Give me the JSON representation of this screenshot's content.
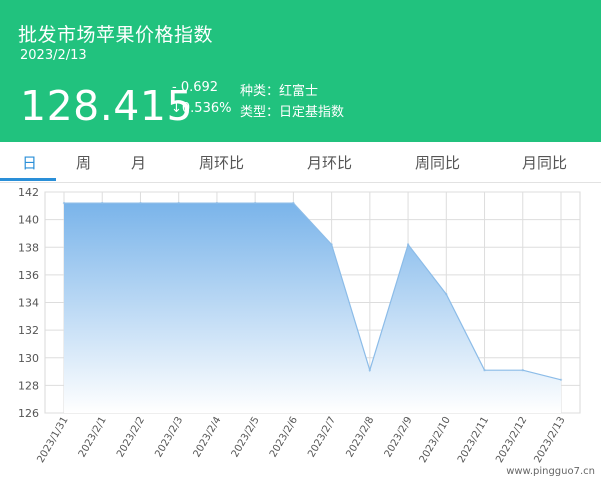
{
  "header": {
    "title": "批发市场苹果价格指数",
    "date": "2023/2/13",
    "value": "128.415",
    "change": "- 0.692",
    "change_pct": "↓0.536%",
    "variety_label": "种类：红富士",
    "type_label": "类型：日定基指数"
  },
  "tabs": [
    {
      "label": "日",
      "active": true
    },
    {
      "label": "周",
      "active": false
    },
    {
      "label": "月",
      "active": false
    },
    {
      "label": "周环比",
      "active": false
    },
    {
      "label": "月环比",
      "active": false
    },
    {
      "label": "周同比",
      "active": false
    },
    {
      "label": "月同比",
      "active": false
    }
  ],
  "colors": {
    "header_bg": "#21c27e",
    "accent": "#2a8fd8",
    "series_top": "#7ab4ea",
    "series_bottom": "#ffffff",
    "series_line": "#8cbce8"
  },
  "watermark": "www.pingguo7.cn",
  "chart_data": {
    "type": "area",
    "x": [
      "2023/1/31",
      "2023/2/1",
      "2023/2/2",
      "2023/2/3",
      "2023/2/4",
      "2023/2/5",
      "2023/2/6",
      "2023/2/7",
      "2023/2/8",
      "2023/2/9",
      "2023/2/10",
      "2023/2/11",
      "2023/2/12",
      "2023/2/13"
    ],
    "values": [
      141.2,
      141.2,
      141.2,
      141.2,
      141.2,
      141.2,
      141.2,
      138.2,
      129.1,
      138.2,
      134.6,
      129.1,
      129.1,
      128.4
    ],
    "ylim": [
      126,
      142
    ],
    "yticks": [
      126,
      128,
      130,
      132,
      134,
      136,
      138,
      140,
      142
    ],
    "grid": true,
    "legend": "none"
  }
}
